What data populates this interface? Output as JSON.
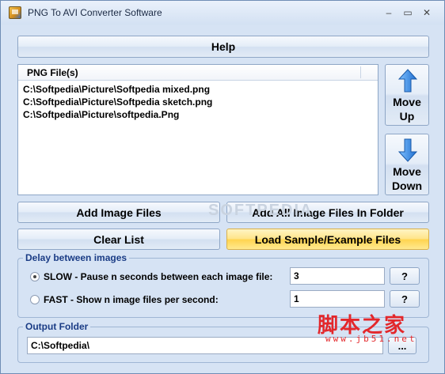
{
  "window": {
    "title": "PNG To AVI Converter Software",
    "controls": {
      "minimize": "–",
      "maximize": "▭",
      "close": "✕"
    }
  },
  "help_button": "Help",
  "file_list": {
    "header": "PNG File(s)",
    "items": [
      "C:\\Softpedia\\Picture\\Softpedia mixed.png",
      "C:\\Softpedia\\Picture\\Softpedia sketch.png",
      "C:\\Softpedia\\Picture\\softpedia.Png"
    ]
  },
  "move_up": {
    "line1": "Move",
    "line2": "Up",
    "icon": "arrow-up-icon"
  },
  "move_down": {
    "line1": "Move",
    "line2": "Down",
    "icon": "arrow-down-icon"
  },
  "buttons": {
    "add_image_files": "Add Image Files",
    "add_all_folder": "Add All Image Files In Folder",
    "clear_list": "Clear List",
    "load_sample": "Load Sample/Example Files"
  },
  "delay_group": {
    "title": "Delay between images",
    "slow_label": "SLOW - Pause n seconds between each image file:",
    "slow_value": "3",
    "fast_label": "FAST - Show n image files per second:",
    "fast_value": "1",
    "selected": "slow",
    "help_symbol": "?"
  },
  "output_group": {
    "title": "Output Folder",
    "value": "C:\\Softpedia\\",
    "browse_label": "..."
  },
  "watermarks": {
    "softpedia": "SOFTPEDIA",
    "site_cn": "脚本之家",
    "site_url": "www.jb51.net"
  },
  "colors": {
    "accent_yellow": "#ffd44f",
    "group_title": "#1a3c85",
    "arrow_blue": "#2f7fd8",
    "watermark_red": "#e3272b"
  }
}
